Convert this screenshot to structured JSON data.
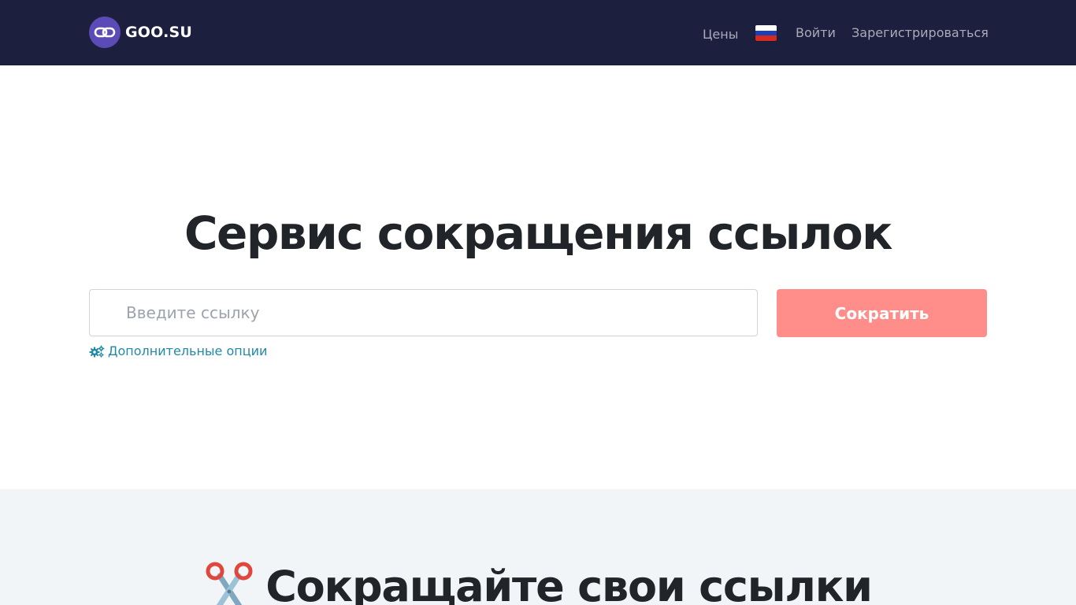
{
  "brand": {
    "name": "GOO.SU",
    "logo_icon": "chain-link-icon",
    "logo_color": "#5b4bb7"
  },
  "nav": {
    "prices": "Цены",
    "language_flag": "russia-flag-icon",
    "login": "Войти",
    "register": "Зарегистрироваться"
  },
  "hero": {
    "title": "Сервис сокращения ссылок",
    "input_placeholder": "Введите ссылку",
    "input_value": "",
    "shorten_button": "Сократить",
    "options_icon": "gears-icon",
    "options_link": "Дополнительные опции"
  },
  "features": {
    "icon": "scissors-icon",
    "title": "Сокращайте свои ссылки"
  },
  "colors": {
    "navbar_bg": "#1c1f3d",
    "button_bg": "#ff8e8a",
    "link_color": "#2189a8",
    "section_bg": "#f1f5f8"
  }
}
